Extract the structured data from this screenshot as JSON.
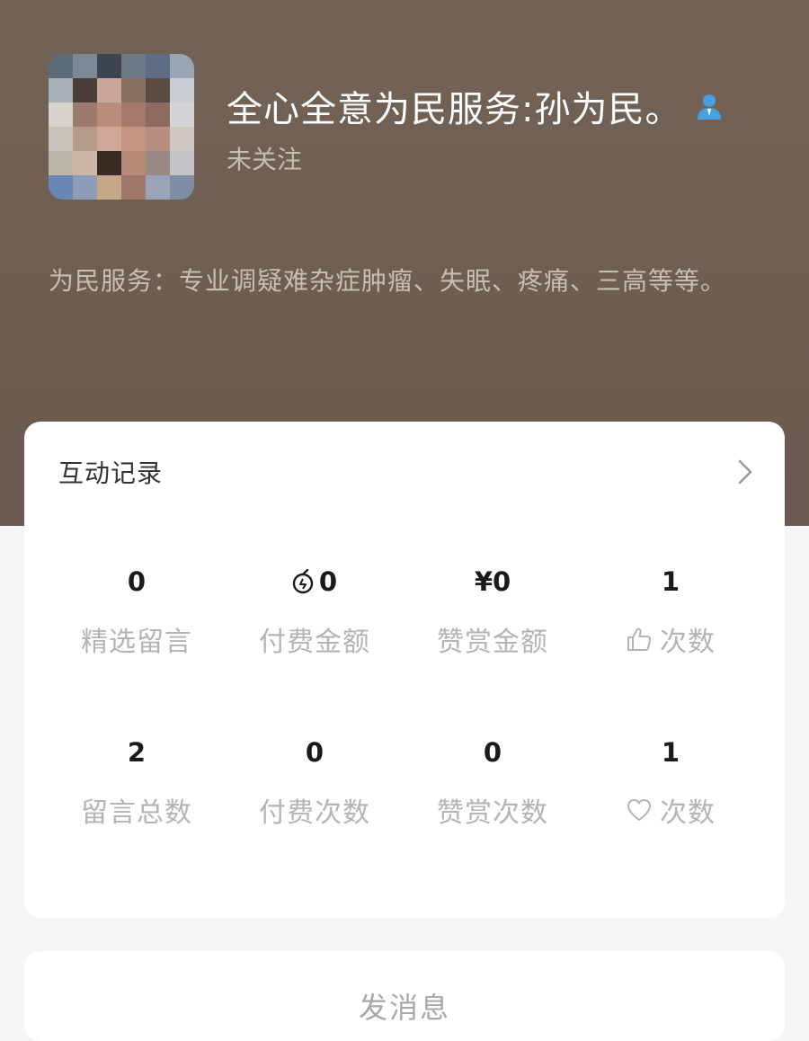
{
  "profile": {
    "name": "全心全意为民服务:孙为民。",
    "follow_status": "未关注",
    "bio": "为民服务：专业调疑难杂症肿瘤、失眠、疼痛、三高等等。",
    "verified_icon": "person-badge-icon"
  },
  "interaction": {
    "title": "互动记录",
    "stats_row1": [
      {
        "value": "0",
        "label": "精选留言"
      },
      {
        "value": "0",
        "label": "付费金额",
        "value_icon": "coin-icon"
      },
      {
        "value": "¥0",
        "label": "赞赏金额"
      },
      {
        "value": "1",
        "label": "次数",
        "label_icon": "thumbs-up-icon"
      }
    ],
    "stats_row2": [
      {
        "value": "2",
        "label": "留言总数"
      },
      {
        "value": "0",
        "label": "付费次数"
      },
      {
        "value": "0",
        "label": "赞赏次数"
      },
      {
        "value": "1",
        "label": "次数",
        "label_icon": "heart-icon"
      }
    ]
  },
  "actions": {
    "send_message": "发消息"
  },
  "colors": {
    "header_bg": "#736357",
    "page_bg": "#f5f6f6",
    "card_bg": "#ffffff",
    "verified_blue": "#4a9fe0"
  }
}
